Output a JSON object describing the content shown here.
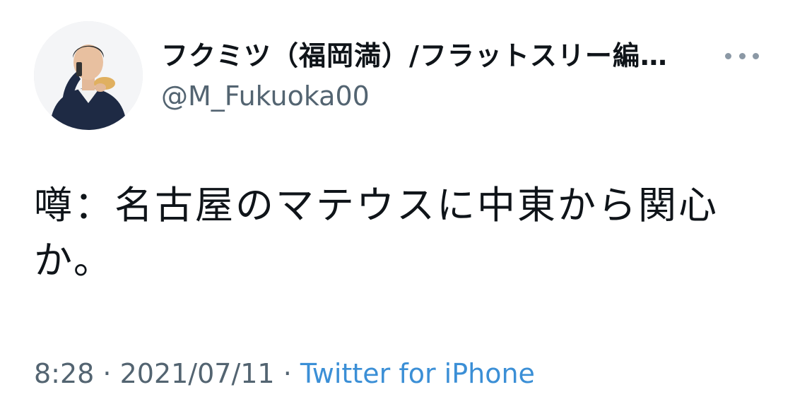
{
  "author": {
    "display_name": "フクミツ（福岡満）/フラットスリー編…",
    "handle": "@M_Fukuoka00",
    "avatar_icon": "avatar-photo"
  },
  "tweet": {
    "text": "噂：名古屋のマテウスに中東から関心か。"
  },
  "meta": {
    "time": "8:28",
    "separator1": " · ",
    "date": "2021/07/11",
    "separator2": " · ",
    "source": "Twitter for iPhone"
  },
  "actions": {
    "more_icon": "more-horizontal-icon"
  },
  "colors": {
    "text": "#0f1419",
    "secondary": "#536471",
    "link": "#3b8fd6",
    "more_dots": "#8b98a5"
  }
}
